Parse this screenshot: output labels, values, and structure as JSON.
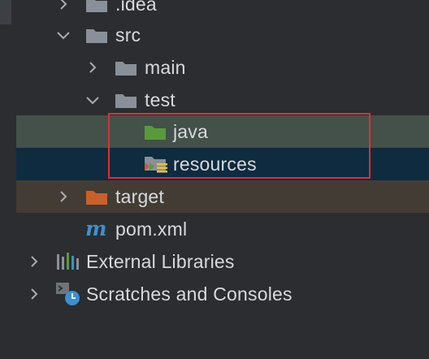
{
  "project_tree": {
    "items": [
      {
        "label": ".idea",
        "icon": "folder-icon"
      },
      {
        "label": "src",
        "icon": "folder-icon"
      },
      {
        "label": "main",
        "icon": "folder-icon"
      },
      {
        "label": "test",
        "icon": "folder-icon"
      },
      {
        "label": "java",
        "icon": "test-sources-folder-icon"
      },
      {
        "label": "resources",
        "icon": "test-resources-folder-icon"
      },
      {
        "label": "target",
        "icon": "excluded-folder-icon"
      },
      {
        "label": "pom.xml",
        "icon": "maven-icon"
      },
      {
        "label": "External Libraries",
        "icon": "libraries-icon"
      },
      {
        "label": "Scratches and Consoles",
        "icon": "scratches-icon"
      }
    ]
  },
  "colors": {
    "background": "#2b2d30",
    "text": "#d7d9dc",
    "folder": "#8a9099",
    "test_sources_folder": "#5a9a3f",
    "excluded_folder": "#c9602b",
    "maven": "#3d8fd1",
    "highlight_border": "#d83232",
    "selected_row": "#0f2b3f",
    "test_row": "#44504a",
    "target_row": "#423c34"
  }
}
